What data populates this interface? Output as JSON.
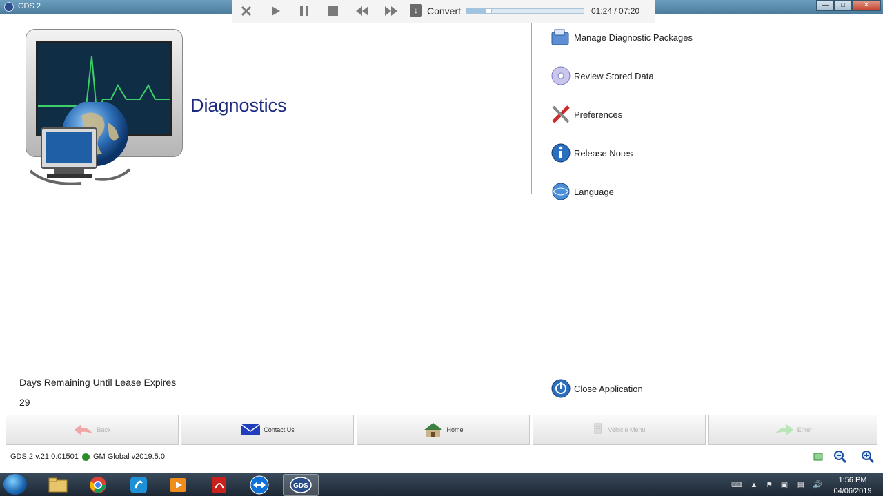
{
  "window": {
    "title": "GDS 2"
  },
  "player": {
    "convert_label": "Convert",
    "current_time": "01:24",
    "total_time": "07:20",
    "time_display": "01:24 / 07:20",
    "progress_fraction": 0.19
  },
  "main": {
    "title": "Diagnostics"
  },
  "menu": {
    "items": [
      {
        "label": "Manage Diagnostic Packages",
        "icon": "folder-box-icon"
      },
      {
        "label": "Review Stored Data",
        "icon": "disc-icon"
      },
      {
        "label": "Preferences",
        "icon": "tools-icon"
      },
      {
        "label": "Release Notes",
        "icon": "info-icon"
      },
      {
        "label": "Language",
        "icon": "language-globe-icon"
      }
    ],
    "close_label": "Close Application"
  },
  "lease": {
    "label": "Days Remaining Until Lease Expires",
    "value": "29"
  },
  "nav": {
    "back": "Back",
    "contact": "Contact Us",
    "home": "Home",
    "vehicle_menu": "Vehicle Menu",
    "enter": "Enter"
  },
  "status": {
    "version": "GDS 2 v.21.0.01501",
    "gm_global": "GM Global v2019.5.0",
    "status_color": "#2b8a2b"
  },
  "taskbar": {
    "time": "1:56 PM",
    "date": "04/06/2019",
    "active_app": "GDS"
  }
}
